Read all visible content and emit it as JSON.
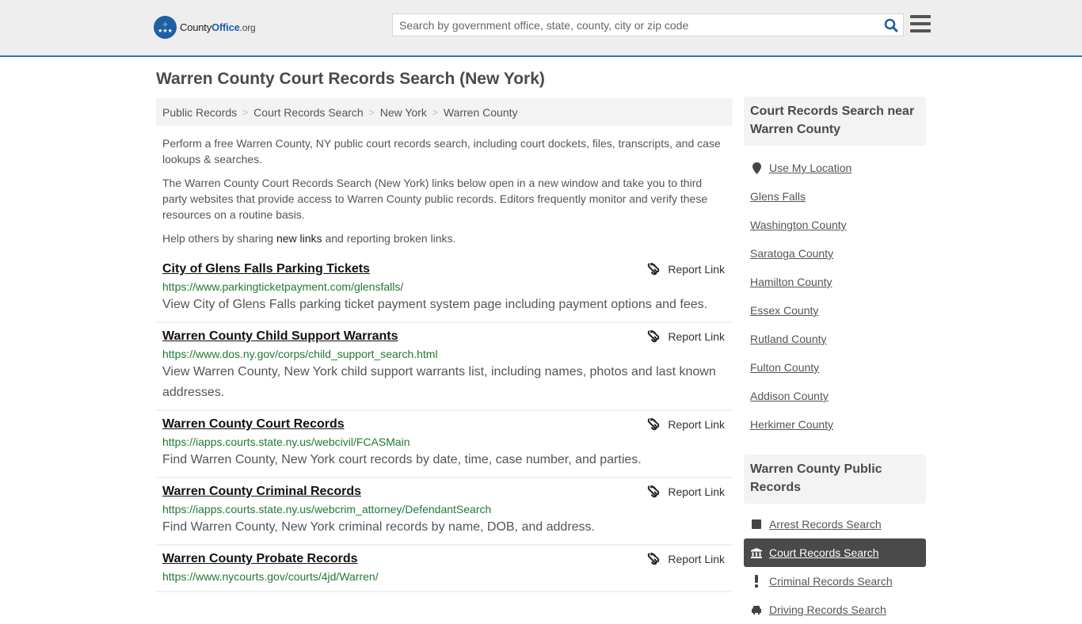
{
  "header": {
    "logo": {
      "county": "County",
      "office": "Office",
      "org": ".org"
    },
    "search_placeholder": "Search by government office, state, county, city or zip code",
    "search_value": "",
    "accent_color": "#2f75b0"
  },
  "page_title": "Warren County Court Records Search (New York)",
  "breadcrumb": [
    "Public Records",
    "Court Records Search",
    "New York",
    "Warren County"
  ],
  "intro": {
    "p1": "Perform a free Warren County, NY public court records search, including court dockets, files, transcripts, and case lookups & searches.",
    "p2": "The Warren County Court Records Search (New York) links below open in a new window and take you to third party websites that provide access to Warren County public records. Editors frequently monitor and verify these resources on a routine basis.",
    "p3_before": "Help others by sharing ",
    "p3_link": "new links",
    "p3_after": " and reporting broken links."
  },
  "report_label": "Report Link",
  "results": [
    {
      "title": "City of Glens Falls Parking Tickets",
      "url": "https://www.parkingticketpayment.com/glensfalls/",
      "desc": "View City of Glens Falls parking ticket payment system page including payment options and fees."
    },
    {
      "title": "Warren County Child Support Warrants",
      "url": "https://www.dos.ny.gov/corps/child_support_search.html",
      "desc": "View Warren County, New York child support warrants list, including names, photos and last known addresses."
    },
    {
      "title": "Warren County Court Records",
      "url": "https://iapps.courts.state.ny.us/webcivil/FCASMain",
      "desc": "Find Warren County, New York court records by date, time, case number, and parties."
    },
    {
      "title": "Warren County Criminal Records",
      "url": "https://iapps.courts.state.ny.us/webcrim_attorney/DefendantSearch",
      "desc": "Find Warren County, New York criminal records by name, DOB, and address."
    },
    {
      "title": "Warren County Probate Records",
      "url": "https://www.nycourts.gov/courts/4jd/Warren/",
      "desc": ""
    }
  ],
  "sidebar": {
    "nearby_title": "Court Records Search near Warren County",
    "use_location": "Use My Location",
    "nearby": [
      "Glens Falls",
      "Washington County",
      "Saratoga County",
      "Hamilton County",
      "Essex County",
      "Rutland County",
      "Fulton County",
      "Addison County",
      "Herkimer County"
    ],
    "public_title": "Warren County Public Records",
    "public_items": [
      {
        "label": "Arrest Records Search",
        "icon": "square-icon",
        "active": false
      },
      {
        "label": "Court Records Search",
        "icon": "courthouse-icon",
        "active": true
      },
      {
        "label": "Criminal Records Search",
        "icon": "exclamation-icon",
        "active": false
      },
      {
        "label": "Driving Records Search",
        "icon": "car-icon",
        "active": false
      }
    ]
  }
}
